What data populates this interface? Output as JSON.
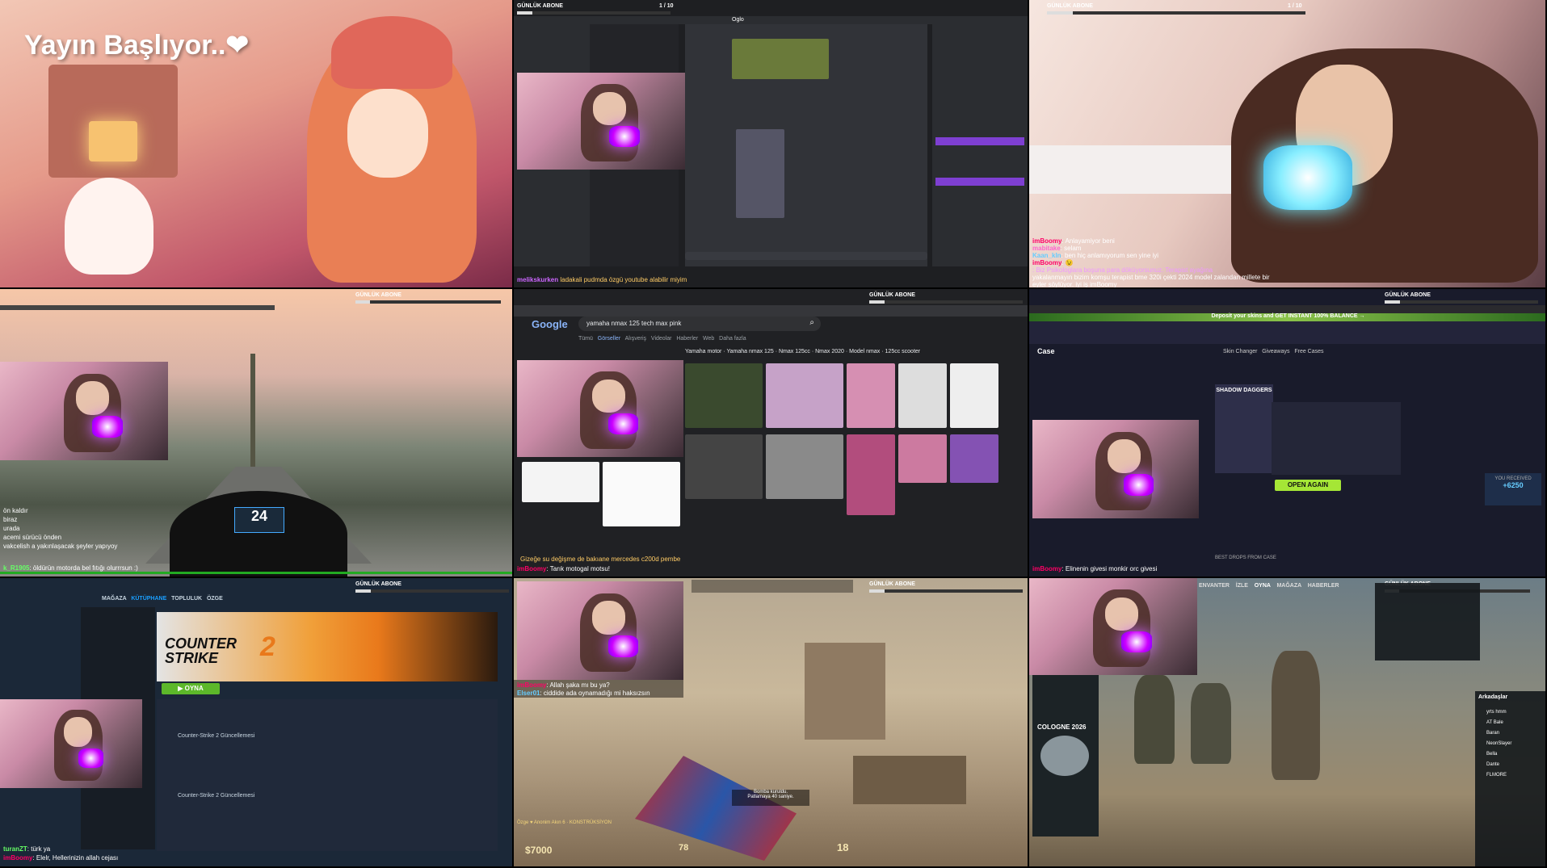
{
  "stream": {
    "sub_goal_label": "GÜNLÜK ABONE",
    "sub_goal_count": "1 / 10",
    "sub_goal_progress": 0.1
  },
  "tile1": {
    "title": "Yayın Başlıyor..❤"
  },
  "tile2": {
    "topbar_left": "Oglo",
    "chat_text": "ladakali pudmda özgü youtube alabilir miyim",
    "chat_nick": "melikskurken"
  },
  "tile3": {
    "chat": [
      {
        "nick": "imBoomy",
        "text": ": Anlayamiyor beni",
        "color": "#f06"
      },
      {
        "nick": "mabitake",
        "text": ": selam",
        "color": "#f6c"
      },
      {
        "nick": "Kaan_kln",
        "text": ": ben hiç anlamıyorum sen yine iyi",
        "color": "#6cf"
      },
      {
        "nick": "imBoomy",
        "text": ": 😉",
        "color": "#f06"
      },
      {
        "nick": "",
        "text": ": Biz Psikologlara boşuna para döküyorsunuz. Terapist ayağına",
        "color": "#c6f"
      },
      {
        "nick": "",
        "text": "yakalanmayın bizim komşu terapist bme 320i çekti 2024 model zalandan millete bir",
        "color": "#fff"
      },
      {
        "nick": "",
        "text": "eyler söylüyor. iyi iş imBoomy",
        "color": "#fff"
      }
    ]
  },
  "tile4": {
    "chat": [
      {
        "nick": "",
        "text": "ön kaldır",
        "color": "#fff"
      },
      {
        "nick": "",
        "text": "biraz",
        "color": "#fff"
      },
      {
        "nick": "",
        "text": "urada",
        "color": "#fff"
      },
      {
        "nick": "",
        "text": "acemi sürücü önden",
        "color": "#fff"
      },
      {
        "nick": "",
        "text": "vakcelish a yakınlaşacak şeyler yapıyoy",
        "color": "#fff"
      },
      {
        "nick": "k_R1905",
        "text": ": öldürün motorda bel fıtığı olurrrsun :)",
        "color": "#6f6"
      }
    ],
    "speed": "24"
  },
  "tile5": {
    "search_query": "yamaha nmax 125 tech max pink",
    "logo": "Google",
    "tabs": [
      "Tümü",
      "Görseller",
      "Alışveriş",
      "Videolar",
      "Haberler",
      "Web",
      "Daha fazla"
    ],
    "chips": [
      "Yamaha motor",
      "Yamaha nmax 125",
      "Nmax 125cc",
      "Nmax 2020",
      "Model nmax",
      "125cc scooter"
    ],
    "chat_nick": "imBoomy",
    "chat_text": ": Tarık motogal motsu!",
    "chat_bottom": "Gizeğe su değişme de bakıane mercedes c200d pembe"
  },
  "tile6": {
    "banner": "Deposit your skins and GET INSTANT 100% BALANCE →",
    "site_logo": "Case",
    "nav": [
      "Skin Changer",
      "Giveaways",
      "Free Cases"
    ],
    "case_name": "SHADOW DAGGERS",
    "open_button": "OPEN AGAIN",
    "best_drops": "BEST DROPS FROM CASE",
    "you_received": "YOU RECEIVED",
    "received_value": "+6250",
    "chat_nick": "imBoomy",
    "chat_text": ": Elinenin givesi monkir orc givesi"
  },
  "tile7": {
    "steam_nav": [
      "MAĞAZA",
      "KÜTÜPHANE",
      "TOPLULUK",
      "ÖZGE"
    ],
    "game_title": "COUNTER STRIKE",
    "game_number": "2",
    "play_button": "▶ OYNA",
    "news_1": "Counter-Strike 2 Güncellemesi",
    "news_2": "Counter-Strike 2 Güncellemesi",
    "chat": [
      {
        "nick": "turanZT",
        "text": ": türk ya",
        "color": "#6f6"
      },
      {
        "nick": "imBoomy",
        "text": ": Elelr, Hellerinizin allah cejası",
        "color": "#f06"
      }
    ]
  },
  "tile8": {
    "chat": [
      {
        "nick": "imBoomy",
        "text": ": Allah şaka mı bu ya?",
        "color": "#f06"
      },
      {
        "nick": "Elser01",
        "text": ": ciddide ada oynamadığı mi haksızsın",
        "color": "#6cf"
      }
    ],
    "money": "$7000",
    "ammo": "18",
    "armor": "78",
    "bomb_msg_1": "Bomba kuruldu.",
    "bomb_msg_2": "Patlamaya 40 saniye.",
    "killfeed": "Özge ♥ Anonim Akın 6 · KONSTRÜKSİYON"
  },
  "tile9": {
    "menu": [
      "ENVANTER",
      "İZLE",
      "OYNA",
      "MAĞAZA",
      "HABERLER"
    ],
    "ad_title": "COLOGNE 2026",
    "friends_header": "Arkadaşlar",
    "friends": [
      "yrts hmm",
      "AT Bale",
      "Baran",
      "NeonSlayer",
      "Bella",
      "Dante",
      "FLMORE"
    ]
  }
}
